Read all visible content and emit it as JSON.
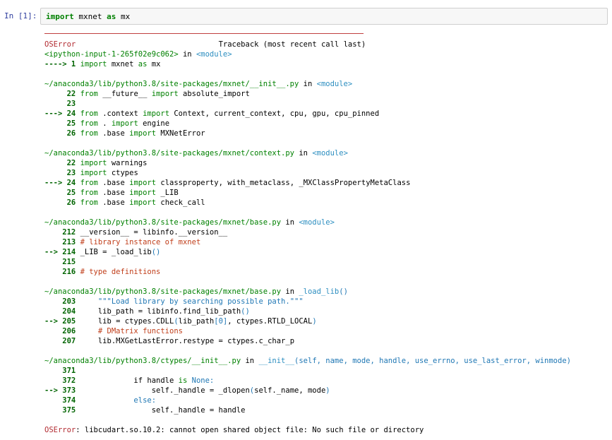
{
  "cell": {
    "prompt": "In  [1]:",
    "code_kw1": "import",
    "code_mod": "mxnet",
    "code_kw2": "as",
    "code_alias": "mx"
  },
  "traceback": {
    "header_error": "OSError",
    "header_right": "Traceback (most recent call last)",
    "lines": [
      [
        {
          "t": "<ipython-input-1-265f02e9c062>",
          "c": "green"
        },
        {
          "t": " in ",
          "c": ""
        },
        {
          "t": "<module>",
          "c": "cyan"
        }
      ],
      [
        {
          "t": "----> 1 ",
          "c": "arrow"
        },
        {
          "t": "import",
          "c": "green"
        },
        {
          "t": " mxnet ",
          "c": ""
        },
        {
          "t": "as",
          "c": "green"
        },
        {
          "t": " mx",
          "c": ""
        }
      ],
      [
        {
          "t": "",
          "c": ""
        }
      ],
      [
        {
          "t": "~/anaconda3/lib/python3.8/site-packages/mxnet/__init__.py",
          "c": "green"
        },
        {
          "t": " in ",
          "c": ""
        },
        {
          "t": "<module>",
          "c": "cyan"
        }
      ],
      [
        {
          "t": "     22 ",
          "c": "num"
        },
        {
          "t": "from",
          "c": "green"
        },
        {
          "t": " __future__ ",
          "c": ""
        },
        {
          "t": "import",
          "c": "green"
        },
        {
          "t": " absolute_import",
          "c": ""
        }
      ],
      [
        {
          "t": "     23",
          "c": "num"
        }
      ],
      [
        {
          "t": "---> 24 ",
          "c": "arrow"
        },
        {
          "t": "from",
          "c": "green"
        },
        {
          "t": " .context ",
          "c": ""
        },
        {
          "t": "import",
          "c": "green"
        },
        {
          "t": " Context, current_context, cpu, gpu, cpu_pinned",
          "c": ""
        }
      ],
      [
        {
          "t": "     25 ",
          "c": "num"
        },
        {
          "t": "from",
          "c": "green"
        },
        {
          "t": " . ",
          "c": ""
        },
        {
          "t": "import",
          "c": "green"
        },
        {
          "t": " engine",
          "c": ""
        }
      ],
      [
        {
          "t": "     26 ",
          "c": "num"
        },
        {
          "t": "from",
          "c": "green"
        },
        {
          "t": " .base ",
          "c": ""
        },
        {
          "t": "import",
          "c": "green"
        },
        {
          "t": " MXNetError",
          "c": ""
        }
      ],
      [
        {
          "t": "",
          "c": ""
        }
      ],
      [
        {
          "t": "~/anaconda3/lib/python3.8/site-packages/mxnet/context.py",
          "c": "green"
        },
        {
          "t": " in ",
          "c": ""
        },
        {
          "t": "<module>",
          "c": "cyan"
        }
      ],
      [
        {
          "t": "     22 ",
          "c": "num"
        },
        {
          "t": "import",
          "c": "green"
        },
        {
          "t": " warnings",
          "c": ""
        }
      ],
      [
        {
          "t": "     23 ",
          "c": "num"
        },
        {
          "t": "import",
          "c": "green"
        },
        {
          "t": " ctypes",
          "c": ""
        }
      ],
      [
        {
          "t": "---> 24 ",
          "c": "arrow"
        },
        {
          "t": "from",
          "c": "green"
        },
        {
          "t": " .base ",
          "c": ""
        },
        {
          "t": "import",
          "c": "green"
        },
        {
          "t": " classproperty, with_metaclass, _MXClassPropertyMetaClass",
          "c": ""
        }
      ],
      [
        {
          "t": "     25 ",
          "c": "num"
        },
        {
          "t": "from",
          "c": "green"
        },
        {
          "t": " .base ",
          "c": ""
        },
        {
          "t": "import",
          "c": "green"
        },
        {
          "t": " _LIB",
          "c": ""
        }
      ],
      [
        {
          "t": "     26 ",
          "c": "num"
        },
        {
          "t": "from",
          "c": "green"
        },
        {
          "t": " .base ",
          "c": ""
        },
        {
          "t": "import",
          "c": "green"
        },
        {
          "t": " check_call",
          "c": ""
        }
      ],
      [
        {
          "t": "",
          "c": ""
        }
      ],
      [
        {
          "t": "~/anaconda3/lib/python3.8/site-packages/mxnet/base.py",
          "c": "green"
        },
        {
          "t": " in ",
          "c": ""
        },
        {
          "t": "<module>",
          "c": "cyan"
        }
      ],
      [
        {
          "t": "    212 ",
          "c": "num"
        },
        {
          "t": "__version__ = libinfo.__version__",
          "c": ""
        }
      ],
      [
        {
          "t": "    213 ",
          "c": "num"
        },
        {
          "t": "# library instance of mxnet",
          "c": "comment"
        }
      ],
      [
        {
          "t": "--> 214 ",
          "c": "arrow"
        },
        {
          "t": "_LIB = _load_lib",
          "c": ""
        },
        {
          "t": "()",
          "c": "blue"
        }
      ],
      [
        {
          "t": "    215",
          "c": "num"
        }
      ],
      [
        {
          "t": "    216 ",
          "c": "num"
        },
        {
          "t": "# type definitions",
          "c": "comment"
        }
      ],
      [
        {
          "t": "",
          "c": ""
        }
      ],
      [
        {
          "t": "~/anaconda3/lib/python3.8/site-packages/mxnet/base.py",
          "c": "green"
        },
        {
          "t": " in ",
          "c": ""
        },
        {
          "t": "_load_lib",
          "c": "cyan"
        },
        {
          "t": "()",
          "c": "blue"
        }
      ],
      [
        {
          "t": "    203 ",
          "c": "num"
        },
        {
          "t": "    \"\"\"Load library by searching possible path.\"\"\"",
          "c": "blue"
        }
      ],
      [
        {
          "t": "    204 ",
          "c": "num"
        },
        {
          "t": "    lib_path = libinfo.find_lib_path",
          "c": ""
        },
        {
          "t": "()",
          "c": "blue"
        }
      ],
      [
        {
          "t": "--> 205 ",
          "c": "arrow"
        },
        {
          "t": "    lib = ctypes.CDLL",
          "c": ""
        },
        {
          "t": "(",
          "c": "blue"
        },
        {
          "t": "lib_path",
          "c": ""
        },
        {
          "t": "[0]",
          "c": "blue"
        },
        {
          "t": ", ctypes.RTLD_LOCAL",
          "c": ""
        },
        {
          "t": ")",
          "c": "blue"
        }
      ],
      [
        {
          "t": "    206 ",
          "c": "num"
        },
        {
          "t": "    # DMatrix functions",
          "c": "comment"
        }
      ],
      [
        {
          "t": "    207 ",
          "c": "num"
        },
        {
          "t": "    lib.MXGetLastError.restype = ctypes.c_char_p",
          "c": ""
        }
      ],
      [
        {
          "t": "",
          "c": ""
        }
      ],
      [
        {
          "t": "~/anaconda3/lib/python3.8/ctypes/__init__.py",
          "c": "green"
        },
        {
          "t": " in ",
          "c": ""
        },
        {
          "t": "__init__",
          "c": "cyan"
        },
        {
          "t": "(self, name, mode, handle, use_errno, use_last_error, winmode)",
          "c": "blue"
        }
      ],
      [
        {
          "t": "    371",
          "c": "num"
        }
      ],
      [
        {
          "t": "    372 ",
          "c": "num"
        },
        {
          "t": "            if handle ",
          "c": ""
        },
        {
          "t": "is",
          "c": "green"
        },
        {
          "t": " None:",
          "c": "blue"
        }
      ],
      [
        {
          "t": "--> 373 ",
          "c": "arrow"
        },
        {
          "t": "                self._handle = _dlopen",
          "c": ""
        },
        {
          "t": "(",
          "c": "blue"
        },
        {
          "t": "self._name, mode",
          "c": ""
        },
        {
          "t": ")",
          "c": "blue"
        }
      ],
      [
        {
          "t": "    374 ",
          "c": "num"
        },
        {
          "t": "            else:",
          "c": "blue"
        }
      ],
      [
        {
          "t": "    375 ",
          "c": "num"
        },
        {
          "t": "                self._handle = handle",
          "c": ""
        }
      ],
      [
        {
          "t": "",
          "c": ""
        }
      ],
      [
        {
          "t": "OSError",
          "c": "red"
        },
        {
          "t": ": libcudart.so.10.2: cannot open shared object file: No such file or directory",
          "c": ""
        }
      ]
    ]
  }
}
